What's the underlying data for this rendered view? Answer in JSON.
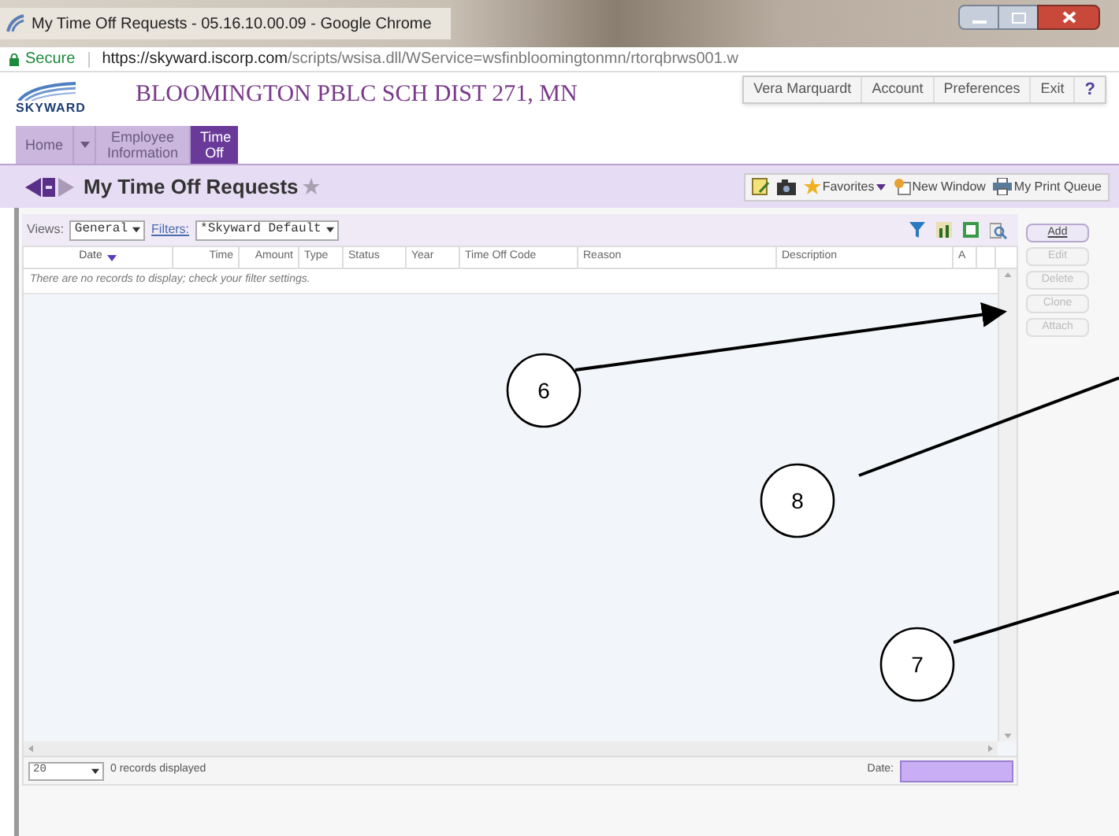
{
  "window": {
    "title": "My Time Off Requests - 05.16.10.00.09 - Google Chrome"
  },
  "address_bar": {
    "secure_label": "Secure",
    "url_host": "https://skyward.iscorp.com",
    "url_path": "/scripts/wsisa.dll/WService=wsfinbloomingtonmn/rtorqbrws001.w"
  },
  "header": {
    "logo_text": "SKYWARD",
    "district": "BLOOMINGTON PBLC SCH DIST 271, MN",
    "user_links": [
      "Vera Marquardt",
      "Account",
      "Preferences",
      "Exit",
      "?"
    ]
  },
  "nav_tabs": [
    {
      "label": "Home",
      "selected": false
    },
    {
      "label": "Employee Information",
      "selected": false
    },
    {
      "label": "Time Off",
      "selected": true
    }
  ],
  "page_title": "My Time Off Requests",
  "toolbar": [
    {
      "kind": "notes"
    },
    {
      "kind": "camera"
    },
    {
      "kind": "favorites",
      "label": "Favorites"
    },
    {
      "kind": "window",
      "label": "New Window"
    },
    {
      "kind": "print",
      "label": "My Print Queue"
    }
  ],
  "filters": {
    "views_label": "Views:",
    "view": "General",
    "filters_label": "Filters:",
    "filter": "*Skyward Default"
  },
  "table": {
    "columns": [
      {
        "label": "Date",
        "sorted": true
      },
      {
        "label": "Time",
        "sorted": false
      },
      {
        "label": "Amount",
        "sorted": false
      },
      {
        "label": "Type",
        "sorted": false
      },
      {
        "label": "Status",
        "sorted": false
      },
      {
        "label": "Year",
        "sorted": false
      },
      {
        "label": "Time Off Code",
        "sorted": false
      },
      {
        "label": "Reason",
        "sorted": false
      },
      {
        "label": "Description",
        "sorted": false
      },
      {
        "label": "A",
        "sorted": false
      }
    ],
    "empty_message": "There are no records to display; check your filter settings."
  },
  "side_buttons": [
    {
      "label": "Add",
      "disabled": false
    },
    {
      "label": "Edit",
      "disabled": true
    },
    {
      "label": "Delete",
      "disabled": true
    },
    {
      "label": "Clone",
      "disabled": true
    },
    {
      "label": "Attach",
      "disabled": true
    }
  ],
  "footer": {
    "page_size": "20",
    "records": "0 records displayed",
    "date_label": "Date:"
  },
  "callouts": [
    {
      "label": "6"
    },
    {
      "label": "8"
    },
    {
      "label": "7"
    }
  ]
}
